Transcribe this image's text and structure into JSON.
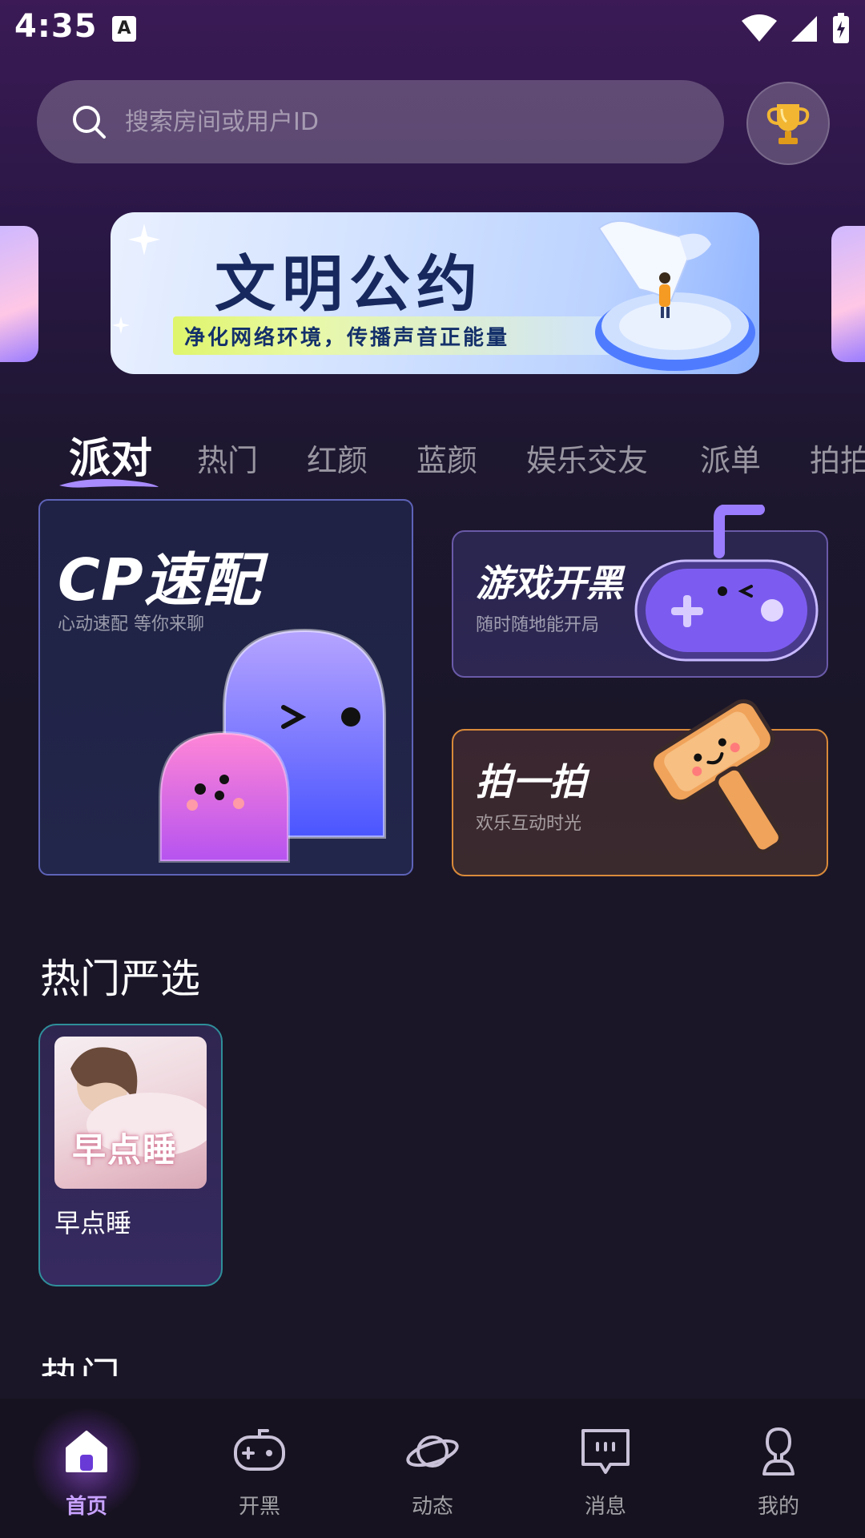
{
  "status_bar": {
    "time": "4:35",
    "app_icon_letter": "A"
  },
  "search": {
    "placeholder": "搜索房间或用户ID"
  },
  "banner": {
    "title": "文明公约",
    "subtitle": "净化网络环境，传播声音正能量"
  },
  "tabs": [
    {
      "label": "派对",
      "active": true
    },
    {
      "label": "热门"
    },
    {
      "label": "红颜"
    },
    {
      "label": "蓝颜"
    },
    {
      "label": "娱乐交友"
    },
    {
      "label": "派单"
    },
    {
      "label": "拍拍"
    }
  ],
  "cards": {
    "cp": {
      "title": "CP速配",
      "subtitle": "心动速配 等你来聊"
    },
    "game": {
      "title": "游戏开黑",
      "subtitle": "随时随地能开局"
    },
    "clap": {
      "title": "拍一拍",
      "subtitle": "欢乐互动时光"
    }
  },
  "section": {
    "title": "热门严选",
    "rooms": [
      {
        "name": "早点睡",
        "thumb_text": "早点睡"
      }
    ],
    "next_section_title": "热门"
  },
  "bottom_nav": [
    {
      "label": "首页",
      "icon": "home-icon",
      "active": true
    },
    {
      "label": "开黑",
      "icon": "gamepad-icon"
    },
    {
      "label": "动态",
      "icon": "planet-icon"
    },
    {
      "label": "消息",
      "icon": "message-icon"
    },
    {
      "label": "我的",
      "icon": "profile-icon"
    }
  ],
  "colors": {
    "accent": "#c8a2ff",
    "cp_border": "#5e63b8",
    "game_border": "#6a5aa8",
    "clap_border": "#d98a3a",
    "room_border": "#2f8f9a"
  }
}
